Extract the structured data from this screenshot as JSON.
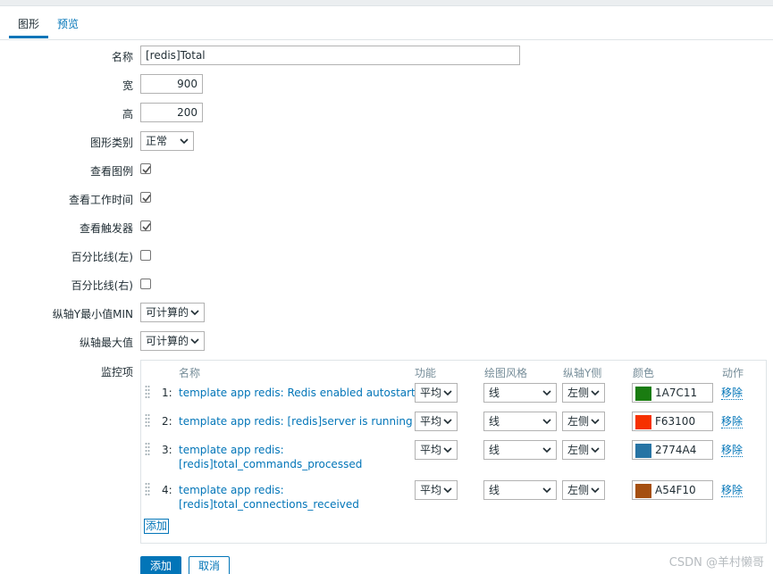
{
  "tabs": [
    {
      "label": "图形",
      "active": true
    },
    {
      "label": "预览",
      "active": false
    }
  ],
  "form": {
    "name_label": "名称",
    "name_value": "[redis]Total",
    "width_label": "宽",
    "width_value": "900",
    "height_label": "高",
    "height_value": "200",
    "graph_type_label": "图形类别",
    "graph_type_value": "正常",
    "show_legend_label": "查看图例",
    "show_legend_checked": true,
    "show_worktime_label": "查看工作时间",
    "show_worktime_checked": true,
    "show_triggers_label": "查看触发器",
    "show_triggers_checked": true,
    "percentile_left_label": "百分比线(左)",
    "percentile_left_checked": false,
    "percentile_right_label": "百分比线(右)",
    "percentile_right_checked": false,
    "y_min_label": "纵轴Y最小值MIN",
    "y_min_value": "可计算的",
    "y_max_label": "纵轴最大值",
    "y_max_value": "可计算的",
    "items_label": "监控项"
  },
  "items_table": {
    "headers": {
      "name": "名称",
      "function": "功能",
      "draw_style": "绘图风格",
      "y_axis": "纵轴Y侧",
      "color": "颜色",
      "action": "动作"
    },
    "rows": [
      {
        "num": "1:",
        "name_line1": "template app redis: Redis enabled autostart",
        "name_line2": "",
        "function": "平均",
        "draw_style": "线",
        "y_axis": "左侧",
        "color_hex": "#1A7C11",
        "color_text": "1A7C11",
        "action": "移除"
      },
      {
        "num": "2:",
        "name_line1": "template app redis: [redis]server is running",
        "name_line2": "",
        "function": "平均",
        "draw_style": "线",
        "y_axis": "左侧",
        "color_hex": "#F63100",
        "color_text": "F63100",
        "action": "移除"
      },
      {
        "num": "3:",
        "name_line1": "template app redis:",
        "name_line2": "[redis]total_commands_processed",
        "function": "平均",
        "draw_style": "线",
        "y_axis": "左侧",
        "color_hex": "#2774A4",
        "color_text": "2774A4",
        "action": "移除"
      },
      {
        "num": "4:",
        "name_line1": "template app redis:",
        "name_line2": "[redis]total_connections_received",
        "function": "平均",
        "draw_style": "线",
        "y_axis": "左侧",
        "color_hex": "#A54F10",
        "color_text": "A54F10",
        "action": "移除"
      }
    ],
    "add_label": "添加"
  },
  "buttons": {
    "add": "添加",
    "cancel": "取消"
  },
  "watermark": "CSDN @羊村懒哥"
}
